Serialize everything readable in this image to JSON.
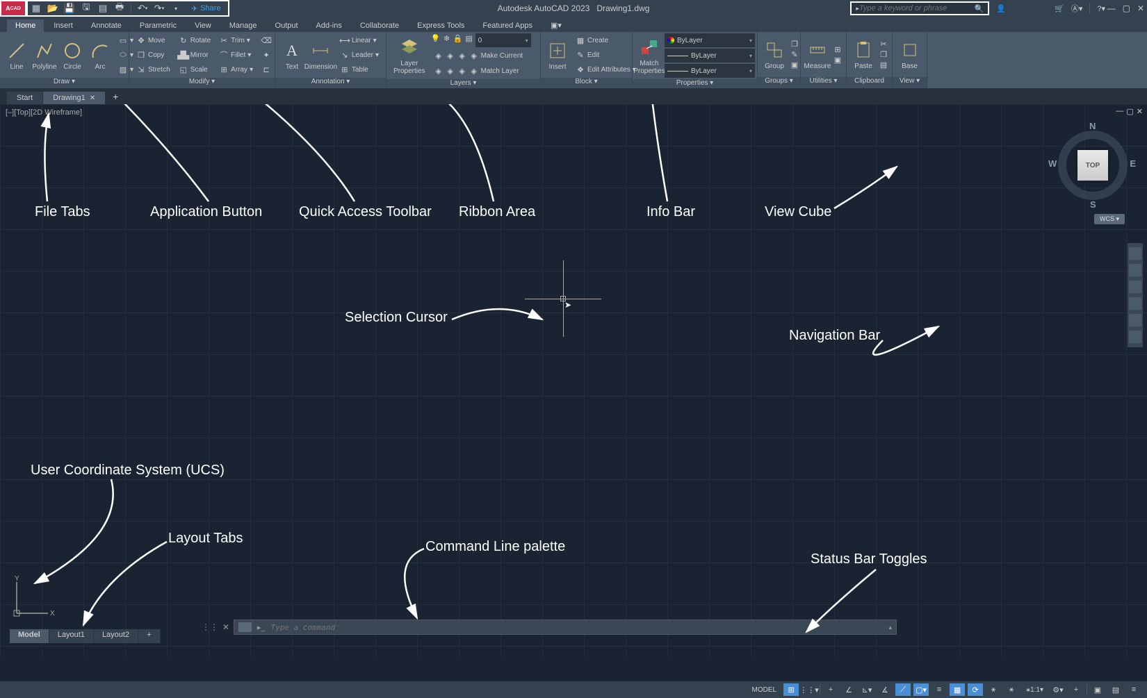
{
  "title": {
    "app": "Autodesk AutoCAD 2023",
    "file": "Drawing1.dwg"
  },
  "qat": {
    "share_label": "Share"
  },
  "search": {
    "placeholder": "Type a keyword or phrase"
  },
  "menu_tabs": [
    "Home",
    "Insert",
    "Annotate",
    "Parametric",
    "View",
    "Manage",
    "Output",
    "Add-ins",
    "Collaborate",
    "Express Tools",
    "Featured Apps"
  ],
  "ribbon": {
    "draw": {
      "title": "Draw ▾",
      "line": "Line",
      "polyline": "Polyline",
      "circle": "Circle",
      "arc": "Arc"
    },
    "modify": {
      "title": "Modify ▾",
      "move": "Move",
      "copy": "Copy",
      "stretch": "Stretch",
      "rotate": "Rotate",
      "mirror": "Mirror",
      "scale": "Scale",
      "trim": "Trim",
      "fillet": "Fillet",
      "array": "Array"
    },
    "annotation": {
      "title": "Annotation ▾",
      "text": "Text",
      "dimension": "Dimension",
      "linear": "Linear",
      "leader": "Leader",
      "table": "Table"
    },
    "layers": {
      "title": "Layers ▾",
      "properties": "Layer\nProperties",
      "current_layer": "0",
      "make_current": "Make Current",
      "match_layer": "Match Layer"
    },
    "block": {
      "title": "Block ▾",
      "insert": "Insert",
      "create": "Create",
      "edit": "Edit",
      "edit_attr": "Edit Attributes"
    },
    "properties": {
      "title": "Properties ▾",
      "match": "Match\nProperties",
      "bylayer1": "ByLayer",
      "bylayer2": "ByLayer",
      "bylayer3": "ByLayer"
    },
    "groups": {
      "title": "Groups ▾",
      "group": "Group"
    },
    "utilities": {
      "title": "Utilities ▾",
      "measure": "Measure"
    },
    "clipboard": {
      "title": "Clipboard",
      "paste": "Paste"
    },
    "view": {
      "title": "View ▾",
      "base": "Base"
    }
  },
  "file_tabs": {
    "start": "Start",
    "drawing1": "Drawing1"
  },
  "viewport": {
    "label": "[–][Top][2D Wireframe]"
  },
  "viewcube": {
    "top": "TOP",
    "n": "N",
    "s": "S",
    "e": "E",
    "w": "W",
    "wcs": "WCS ▾"
  },
  "layout_tabs": [
    "Model",
    "Layout1",
    "Layout2"
  ],
  "cmdline": {
    "placeholder": "Type a command"
  },
  "status": {
    "model": "MODEL",
    "scale": "1:1"
  },
  "annotations": {
    "file_tabs": "File Tabs",
    "app_button": "Application Button",
    "qat": "Quick Access Toolbar",
    "ribbon": "Ribbon Area",
    "info_bar": "Info Bar",
    "view_cube": "View Cube",
    "selection_cursor": "Selection Cursor",
    "nav_bar": "Navigation Bar",
    "ucs": "User Coordinate System (UCS)",
    "layout_tabs": "Layout Tabs",
    "cmdline": "Command Line palette",
    "status_toggles": "Status Bar Toggles"
  }
}
